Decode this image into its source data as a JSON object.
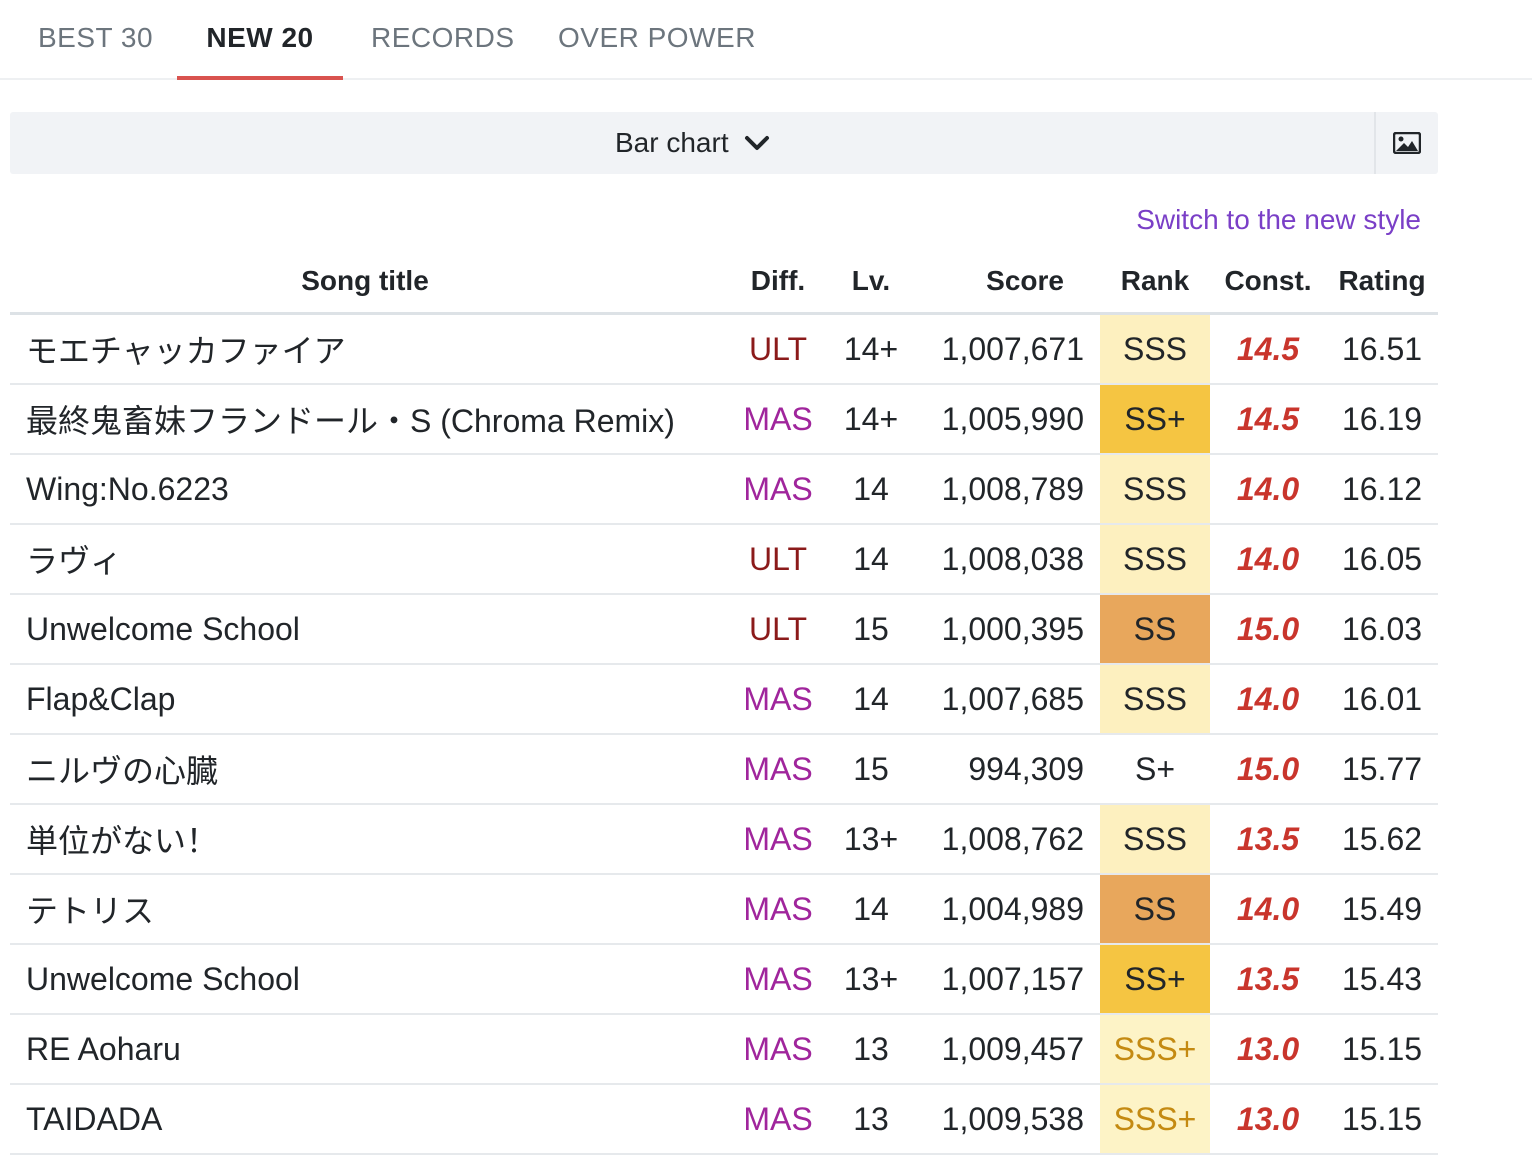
{
  "tabs": [
    {
      "label": "BEST 30",
      "active": false
    },
    {
      "label": "NEW 20",
      "active": true
    },
    {
      "label": "RECORDS",
      "active": false
    },
    {
      "label": "OVER POWER",
      "active": false
    }
  ],
  "chart_selector": {
    "label": "Bar chart",
    "icon": "chevron-down-icon"
  },
  "image_button": {
    "icon": "image-icon"
  },
  "switch_link": "Switch to the new style",
  "table": {
    "headers": {
      "title": "Song title",
      "diff": "Diff.",
      "level": "Lv.",
      "score": "Score",
      "rank": "Rank",
      "const": "Const.",
      "rating": "Rating"
    },
    "rows": [
      {
        "title": "モエチャッカファイア",
        "diff": "ULT",
        "level": "14+",
        "score": "1,007,671",
        "rank": "SSS",
        "const": "14.5",
        "rating": "16.51"
      },
      {
        "title": "最終鬼畜妹フランドール・S (Chroma Remix)",
        "diff": "MAS",
        "level": "14+",
        "score": "1,005,990",
        "rank": "SS+",
        "const": "14.5",
        "rating": "16.19"
      },
      {
        "title": "Wing:No.6223",
        "diff": "MAS",
        "level": "14",
        "score": "1,008,789",
        "rank": "SSS",
        "const": "14.0",
        "rating": "16.12"
      },
      {
        "title": "ラヴィ",
        "diff": "ULT",
        "level": "14",
        "score": "1,008,038",
        "rank": "SSS",
        "const": "14.0",
        "rating": "16.05"
      },
      {
        "title": "Unwelcome School",
        "diff": "ULT",
        "level": "15",
        "score": "1,000,395",
        "rank": "SS",
        "const": "15.0",
        "rating": "16.03"
      },
      {
        "title": "Flap&Clap",
        "diff": "MAS",
        "level": "14",
        "score": "1,007,685",
        "rank": "SSS",
        "const": "14.0",
        "rating": "16.01"
      },
      {
        "title": "ニルヴの心臓",
        "diff": "MAS",
        "level": "15",
        "score": "994,309",
        "rank": "S+",
        "const": "15.0",
        "rating": "15.77"
      },
      {
        "title": "単位がない！",
        "diff": "MAS",
        "level": "13+",
        "score": "1,008,762",
        "rank": "SSS",
        "const": "13.5",
        "rating": "15.62"
      },
      {
        "title": "テトリス",
        "diff": "MAS",
        "level": "14",
        "score": "1,004,989",
        "rank": "SS",
        "const": "14.0",
        "rating": "15.49"
      },
      {
        "title": "Unwelcome School",
        "diff": "MAS",
        "level": "13+",
        "score": "1,007,157",
        "rank": "SS+",
        "const": "13.5",
        "rating": "15.43"
      },
      {
        "title": "RE Aoharu",
        "diff": "MAS",
        "level": "13",
        "score": "1,009,457",
        "rank": "SSS+",
        "const": "13.0",
        "rating": "15.15"
      },
      {
        "title": "TAIDADA",
        "diff": "MAS",
        "level": "13",
        "score": "1,009,538",
        "rank": "SSS+",
        "const": "13.0",
        "rating": "15.15"
      }
    ]
  },
  "colors": {
    "active_tab_underline": "#d9534f",
    "ult": "#8b1a1a",
    "mas": "#a0259c",
    "const": "#c9352c",
    "rank_sss": "#fdf0bf",
    "rank_ss_plus": "#f5c542",
    "rank_ss": "#e8a75c",
    "rank_sss_plus_text": "#c48a12",
    "link": "#7a3fc7"
  }
}
